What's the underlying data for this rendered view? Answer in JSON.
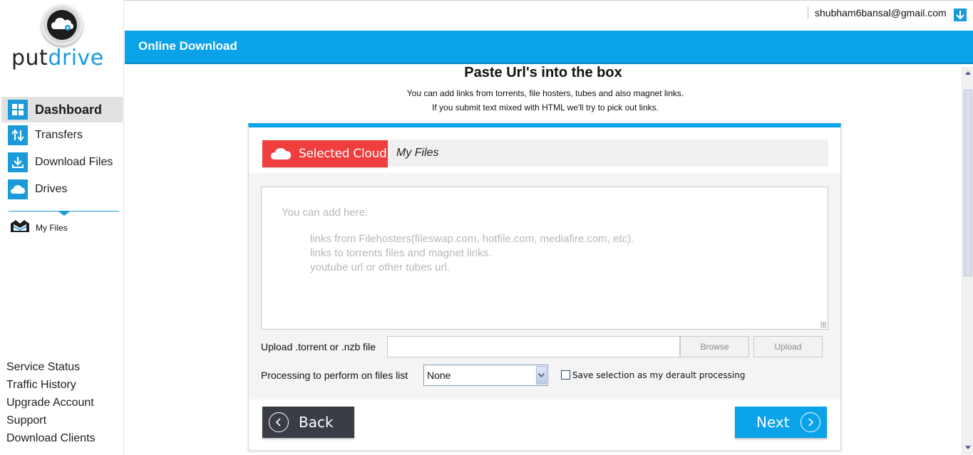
{
  "app": {
    "logo_put": "put",
    "logo_drive": "drive"
  },
  "user": {
    "email": "shubham6bansal@gmail.com"
  },
  "sidebar": {
    "items": [
      {
        "label": "Dashboard",
        "icon": "dashboard-grid-icon",
        "active": true
      },
      {
        "label": "Transfers",
        "icon": "transfer-arrows-icon",
        "active": false
      },
      {
        "label": "Download Files",
        "icon": "download-icon",
        "active": false
      },
      {
        "label": "Drives",
        "icon": "cloud-icon",
        "active": false
      }
    ],
    "sub_item": {
      "label": "My Files",
      "icon": "folder-open-icon"
    },
    "bottom_links": [
      "Service Status",
      "Traffic History",
      "Upgrade Account",
      "Support",
      "Download Clients"
    ]
  },
  "header": {
    "title": "Online Download"
  },
  "main": {
    "title": "Paste Url's into the box",
    "subtitle_line1": "You can add links from torrents, file hosters, tubes and also magnet links.",
    "subtitle_line2": "If you submit text mixed with HTML we'll try to pick out links."
  },
  "cloud_bar": {
    "selected_label": "Selected Cloud",
    "cloud_name": "My Files"
  },
  "links_box": {
    "placeholder_intro": "You can add here:",
    "placeholder_lines": [
      "links from Filehosters(fileswap.com, hotfile.com, mediafire.com, etc).",
      "links to torrents files and magnet links.",
      "youtube url or other tubes url."
    ]
  },
  "upload": {
    "label": "Upload .torrent or .nzb file",
    "browse_label": "Browse",
    "upload_label": "Upload"
  },
  "processing": {
    "label": "Processing to perform on files list",
    "selected": "None",
    "save_label": "Save selection as my derault processing",
    "save_checked": false
  },
  "buttons": {
    "back": "Back",
    "next": "Next"
  },
  "colors": {
    "accent": "#0aa2e8",
    "selected_cloud": "#f03d3d",
    "back_button": "#3b3d46"
  }
}
